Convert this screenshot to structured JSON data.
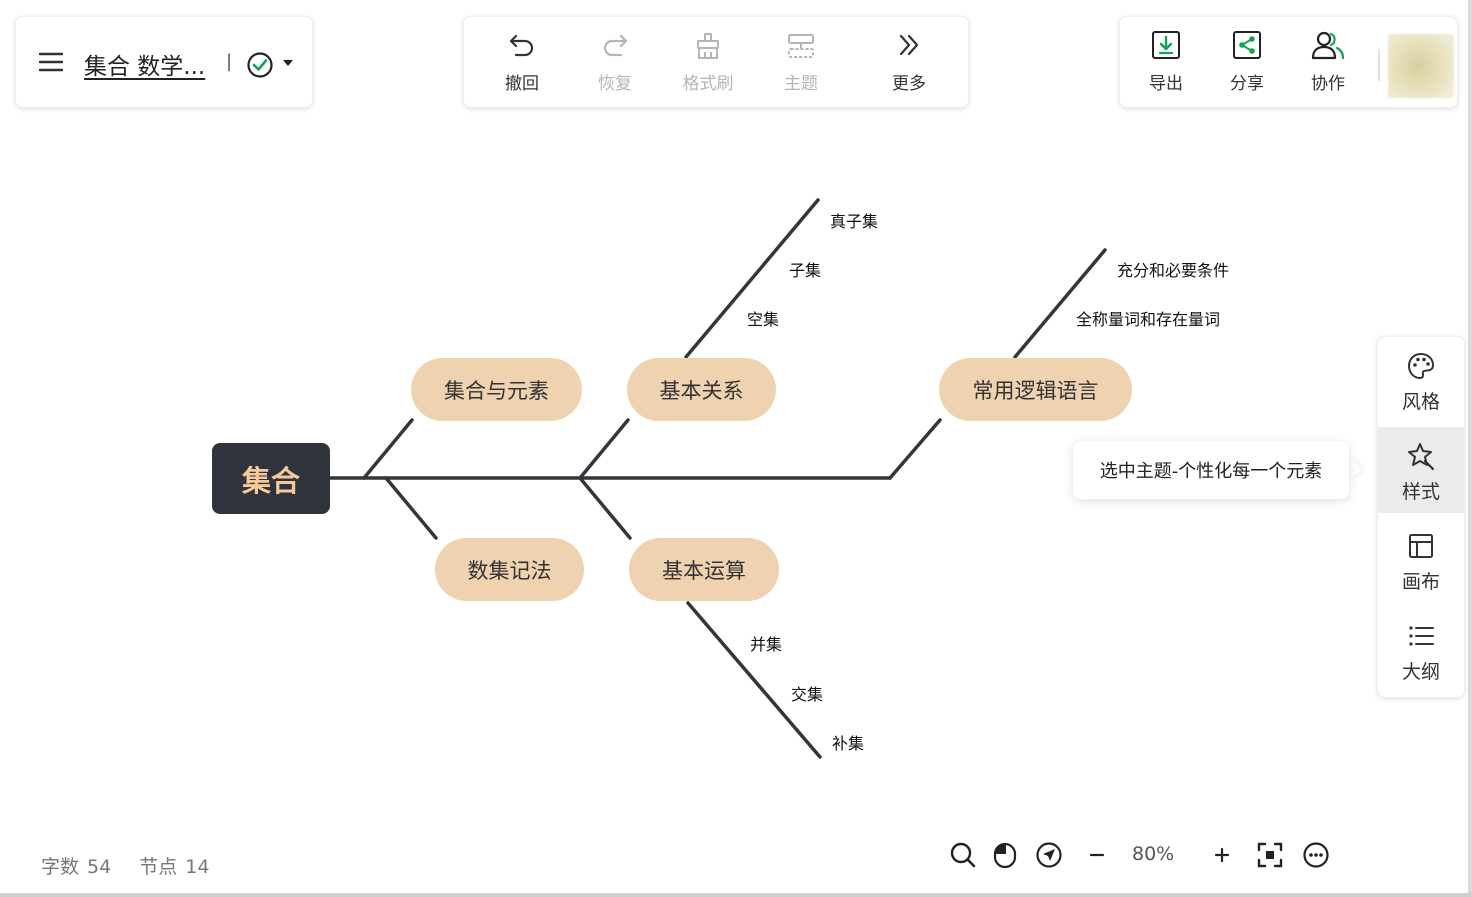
{
  "document": {
    "title": "集合 数学...",
    "separator": "|"
  },
  "toolbar": {
    "undo": "撤回",
    "redo": "恢复",
    "format_painter": "格式刷",
    "theme": "主题",
    "more": "更多"
  },
  "actions": {
    "export": "导出",
    "share": "分享",
    "collaborate": "协作"
  },
  "mindmap": {
    "root": "集合",
    "topics": {
      "set_and_element": "集合与元素",
      "basic_relations": "基本关系",
      "logic_language": "常用逻辑语言",
      "set_notation": "数集记法",
      "basic_operations": "基本运算"
    },
    "leaves": {
      "proper_subset": "真子集",
      "subset": "子集",
      "empty_set": "空集",
      "sufficient_necessary": "充分和必要条件",
      "quantifiers": "全称量词和存在量词",
      "union": "并集",
      "intersection": "交集",
      "complement": "补集"
    }
  },
  "side_panel": {
    "style": "风格",
    "format": "样式",
    "canvas": "画布",
    "outline": "大纲",
    "active": "样式"
  },
  "tooltip": "选中主题-个性化每一个元素",
  "stats": {
    "word_count_label": "字数",
    "word_count": "54",
    "node_count_label": "节点",
    "node_count": "14"
  },
  "zoom": {
    "level": "80%"
  },
  "colors": {
    "root_bg": "#2f343c",
    "root_text": "#f6c99a",
    "topic_bg": "#efd2b0",
    "line": "#33363b",
    "accent_green": "#12a35b"
  }
}
